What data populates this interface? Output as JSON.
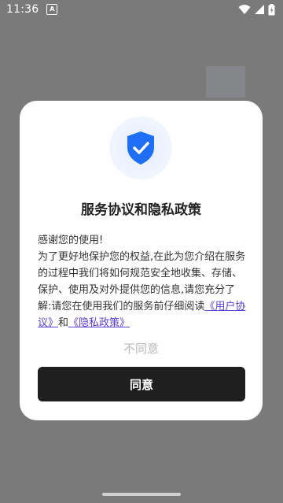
{
  "status_bar": {
    "time": "11:36",
    "notification_badge": "A",
    "icons": [
      "wifi-icon",
      "signal-icon",
      "battery-icon"
    ]
  },
  "dialog": {
    "title": "服务协议和隐私政策",
    "greeting": "感谢您的使用!",
    "paragraph": "为了更好地保护您的权益,在此为您介绍在服务的过程中我们将如何规范安全地收集、存储、保护、使用及对外提供您的信息,请您充分了解:请您在使用我们的服务前仔细阅读",
    "user_agreement_link": "《用户协议》",
    "conjunction": "和",
    "privacy_policy_link": "《隐私政策》",
    "disagree_label": "不同意",
    "agree_label": "同意",
    "shield_icon": "shield-check-icon"
  },
  "colors": {
    "link": "#5b3fd1",
    "agree_button": "#1f1f1f",
    "shield": "#1e6ff5",
    "overlay": "#7a7a7a"
  }
}
